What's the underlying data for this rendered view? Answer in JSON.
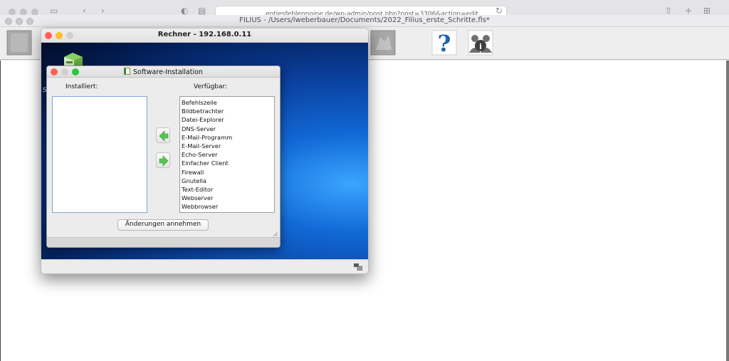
{
  "browser": {
    "url_text": "entiesfeblennoine.de/wp-admin/post.php?post=3306&action=edit"
  },
  "filius": {
    "window_title": "FILIUS - /Users/lweberbauer/Documents/2022_Filius_erste_Schritte.fls*",
    "toolbar": {
      "help_icon": "question-mark-icon",
      "info_icon": "people-info-icon"
    }
  },
  "rechner": {
    "title": "Rechner - 192.168.0.11",
    "desktop_label_fragment": "S"
  },
  "dialog": {
    "title": "Software-Installation",
    "installed_label": "Installiert:",
    "available_label": "Verfügbar:",
    "installed_items": [],
    "available_items": [
      "Befehlszeile",
      "Bildbetrachter",
      "Datei-Explorer",
      "DNS-Server",
      "E-Mail-Programm",
      "E-Mail-Server",
      "Echo-Server",
      "Einfacher Client",
      "Firewall",
      "Gnutella",
      "Text-Editor",
      "Webserver",
      "Webbrowser"
    ],
    "apply_label": "Änderungen annehmen",
    "move_left_icon": "green-arrow-left-icon",
    "move_right_icon": "green-arrow-right-icon"
  },
  "colors": {
    "close": "#ff5f57",
    "minimize": "#febc2e",
    "zoom": "#28c840",
    "arrow_green": "#58c451",
    "desktop_blue": "#1168d6"
  }
}
